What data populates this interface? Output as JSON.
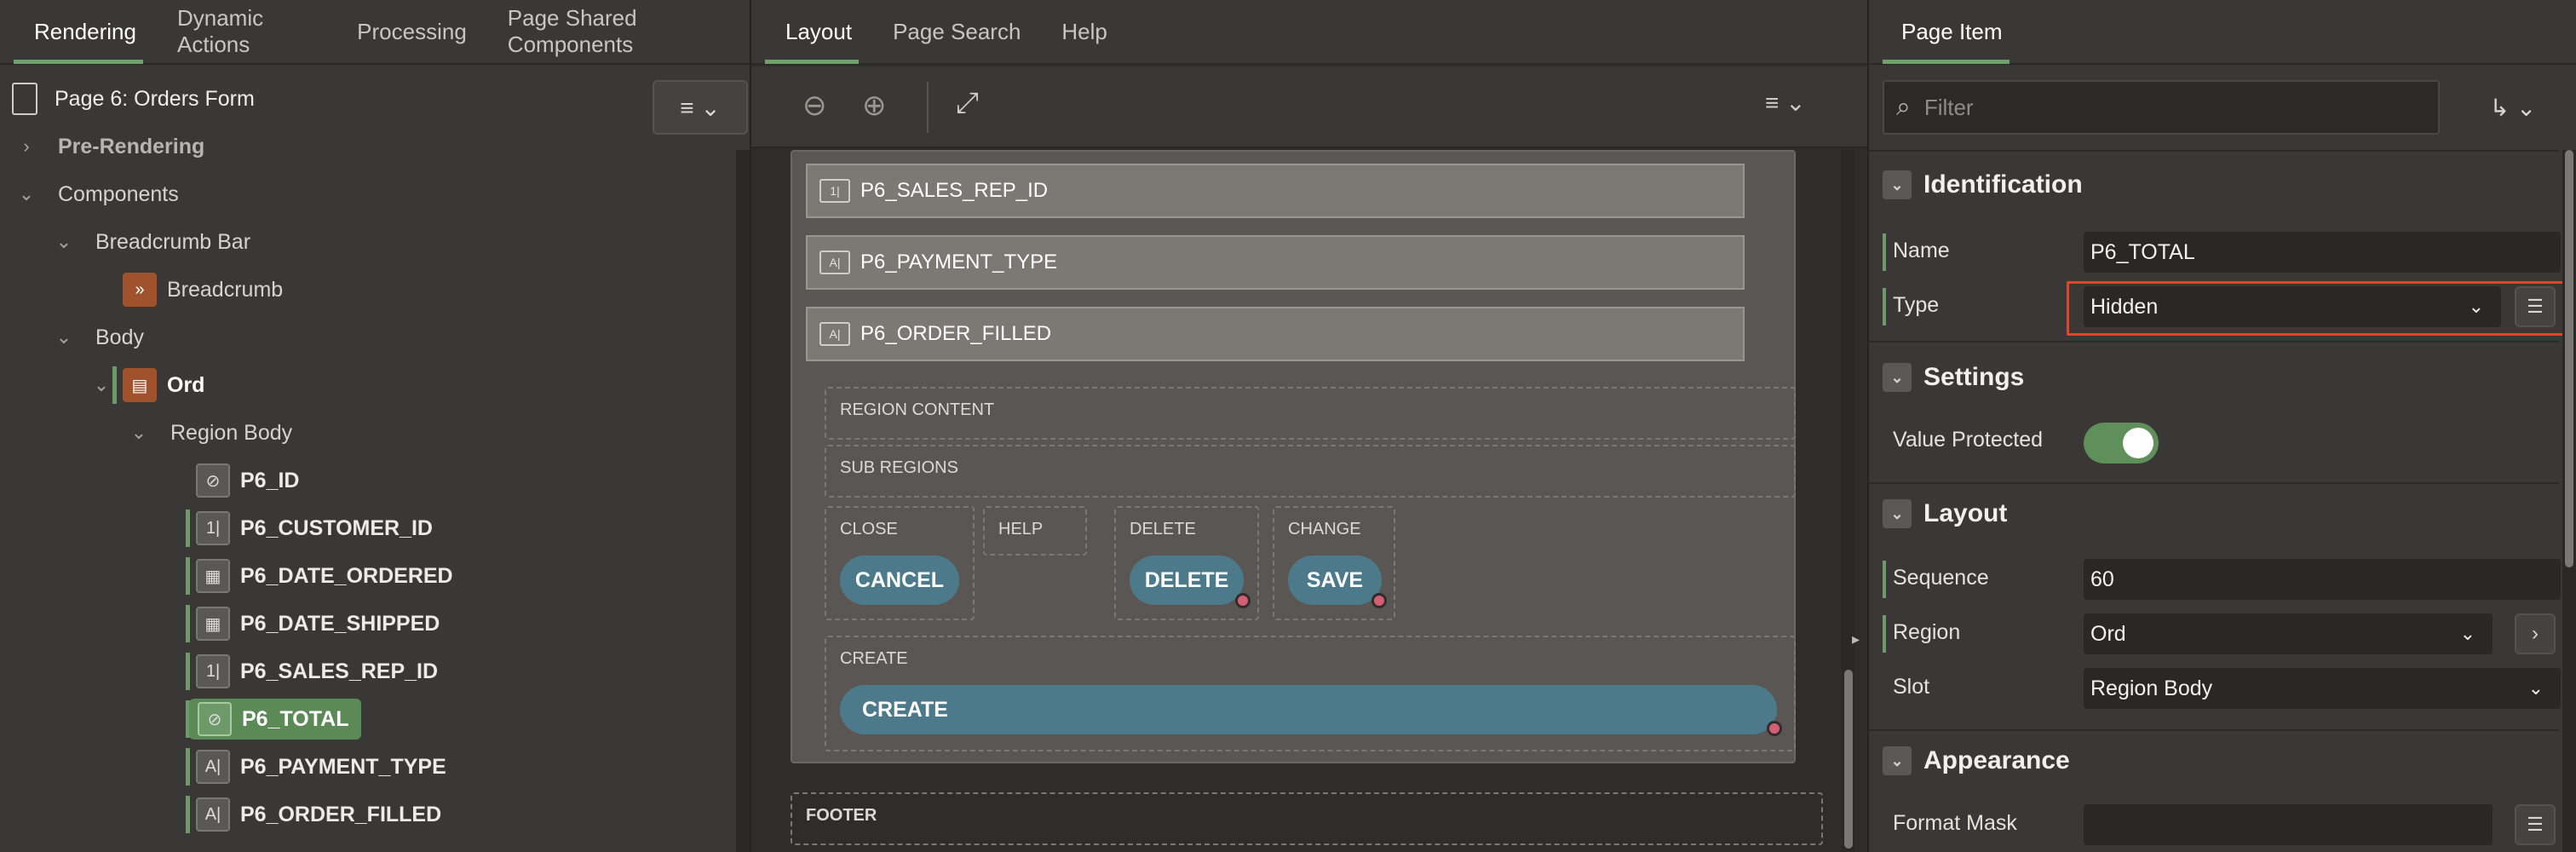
{
  "left": {
    "tabs": [
      "Rendering",
      "Dynamic Actions",
      "Processing",
      "Page Shared Components"
    ],
    "page_title": "Page 6: Orders Form",
    "tree": {
      "pre_rendering": "Pre-Rendering",
      "components": "Components",
      "breadcrumb_bar": "Breadcrumb Bar",
      "breadcrumb": "Breadcrumb",
      "body": "Body",
      "ord": "Ord",
      "region_body": "Region Body",
      "items": [
        "P6_ID",
        "P6_CUSTOMER_ID",
        "P6_DATE_ORDERED",
        "P6_DATE_SHIPPED",
        "P6_SALES_REP_ID",
        "P6_TOTAL",
        "P6_PAYMENT_TYPE",
        "P6_ORDER_FILLED"
      ],
      "selected_item": "P6_TOTAL"
    }
  },
  "middle": {
    "tabs": [
      "Layout",
      "Page Search",
      "Help"
    ],
    "fields": [
      {
        "name": "P6_SALES_REP_ID",
        "icon": "number-field-icon"
      },
      {
        "name": "P6_PAYMENT_TYPE",
        "icon": "text-field-icon"
      },
      {
        "name": "P6_ORDER_FILLED",
        "icon": "text-field-icon"
      }
    ],
    "region_content": "REGION CONTENT",
    "sub_regions": "SUB REGIONS",
    "slots": {
      "close": "CLOSE",
      "help": "HELP",
      "delete": "DELETE",
      "change": "CHANGE",
      "create": "CREATE"
    },
    "buttons": {
      "cancel": "CANCEL",
      "delete": "DELETE",
      "save": "SAVE",
      "create": "CREATE"
    },
    "footer": "FOOTER"
  },
  "right": {
    "tab": "Page Item",
    "filter_placeholder": "Filter",
    "sections": {
      "identification": "Identification",
      "settings": "Settings",
      "layout": "Layout",
      "appearance": "Appearance"
    },
    "props": {
      "name_label": "Name",
      "name_value": "P6_TOTAL",
      "type_label": "Type",
      "type_value": "Hidden",
      "value_protected_label": "Value Protected",
      "value_protected_on": true,
      "sequence_label": "Sequence",
      "sequence_value": "60",
      "region_label": "Region",
      "region_value": "Ord",
      "slot_label": "Slot",
      "slot_value": "Region Body",
      "format_mask_label": "Format Mask",
      "format_mask_value": ""
    }
  },
  "colors": {
    "accent_green": "#6fa26a",
    "highlight": "#e0452a",
    "button_teal": "#4d7a8a"
  }
}
